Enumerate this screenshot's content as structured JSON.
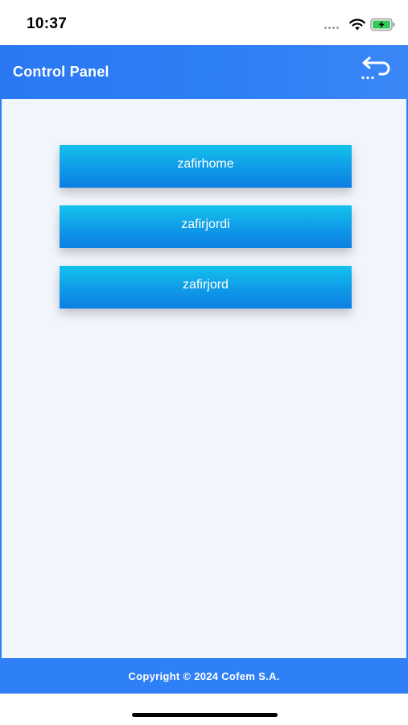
{
  "status_bar": {
    "time": "10:37",
    "icons": [
      "signal-icon",
      "wifi-icon",
      "battery-charging-icon"
    ]
  },
  "header": {
    "title": "Control Panel",
    "back_icon": "back-arrow-icon",
    "color": "#2f7ff6"
  },
  "devices": [
    {
      "label": "zafirhome"
    },
    {
      "label": "zafirjordi"
    },
    {
      "label": "zafirjord"
    }
  ],
  "footer": {
    "copyright": "Copyright © 2024 Cofem S.A."
  },
  "colors": {
    "accent": "#2f7ff6",
    "button_top": "#14c2ec",
    "button_bottom": "#0c7fe3",
    "panel_bg": "#f1f6fd"
  }
}
